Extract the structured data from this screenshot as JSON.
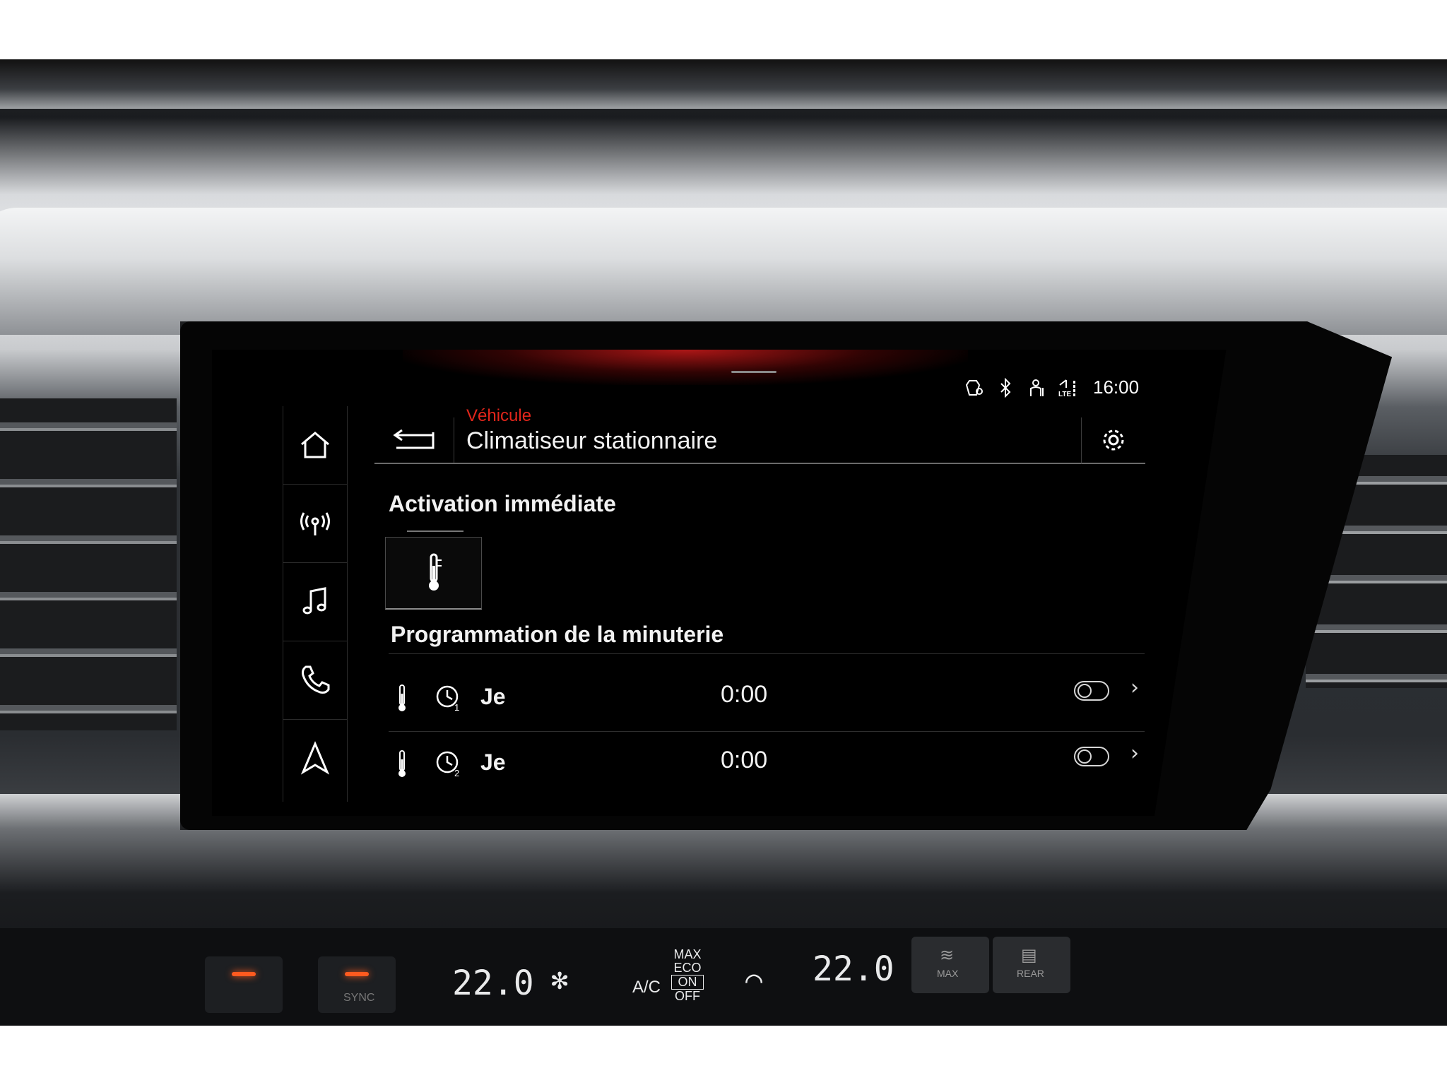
{
  "status_bar": {
    "time": "16:00",
    "icons": [
      "location-shield-icon",
      "bluetooth-icon",
      "user-profile-icon",
      "lte-signal-icon"
    ]
  },
  "side_nav": {
    "items": [
      {
        "icon": "home-icon"
      },
      {
        "icon": "radio-icon"
      },
      {
        "icon": "music-icon"
      },
      {
        "icon": "phone-icon"
      },
      {
        "icon": "navigation-icon"
      }
    ]
  },
  "header": {
    "breadcrumb": "Véhicule",
    "title": "Climatiseur stationnaire",
    "back_icon": "back-arrow-icon",
    "settings_icon": "gear-icon"
  },
  "immediate": {
    "title": "Activation immédiate",
    "tile_icon": "thermometer-icon"
  },
  "timers": {
    "title": "Programmation de la minuterie",
    "rows": [
      {
        "clock_index": "1",
        "day": "Je",
        "time": "0:00",
        "enabled": false
      },
      {
        "clock_index": "2",
        "day": "Je",
        "time": "0:00",
        "enabled": false
      }
    ]
  },
  "climate_panel": {
    "left_temp": "22.0",
    "right_temp": "22.0",
    "ac_label": "A/C",
    "max_label": "MAX",
    "eco_label": "ECO",
    "on_label": "ON",
    "off_label": "OFF",
    "sync_label": "SYNC",
    "defrost_max_label": "MAX",
    "rear_label": "REAR"
  },
  "colors": {
    "accent_red": "#e2261b",
    "screen_bg": "#000000",
    "text": "#f2f2f2"
  }
}
